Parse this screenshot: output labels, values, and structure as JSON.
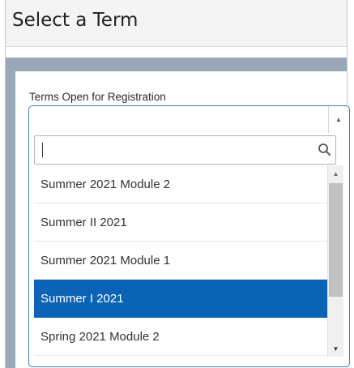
{
  "page": {
    "title": "Select a Term"
  },
  "field": {
    "label": "Terms Open for Registration"
  },
  "search": {
    "value": "",
    "placeholder": ""
  },
  "icons": {
    "search": "search-icon",
    "up": "triangle-up-icon",
    "down": "triangle-down-icon"
  },
  "options": [
    {
      "label": "Summer 2021 Module 2",
      "selected": false
    },
    {
      "label": "Summer II 2021",
      "selected": false
    },
    {
      "label": "Summer 2021 Module 1",
      "selected": false
    },
    {
      "label": "Summer I 2021",
      "selected": true
    },
    {
      "label": "Spring 2021 Module 2",
      "selected": false
    }
  ],
  "colors": {
    "selected": "#0b63b5",
    "accent_border": "#3b7fc4",
    "band": "#9aa7b6"
  }
}
